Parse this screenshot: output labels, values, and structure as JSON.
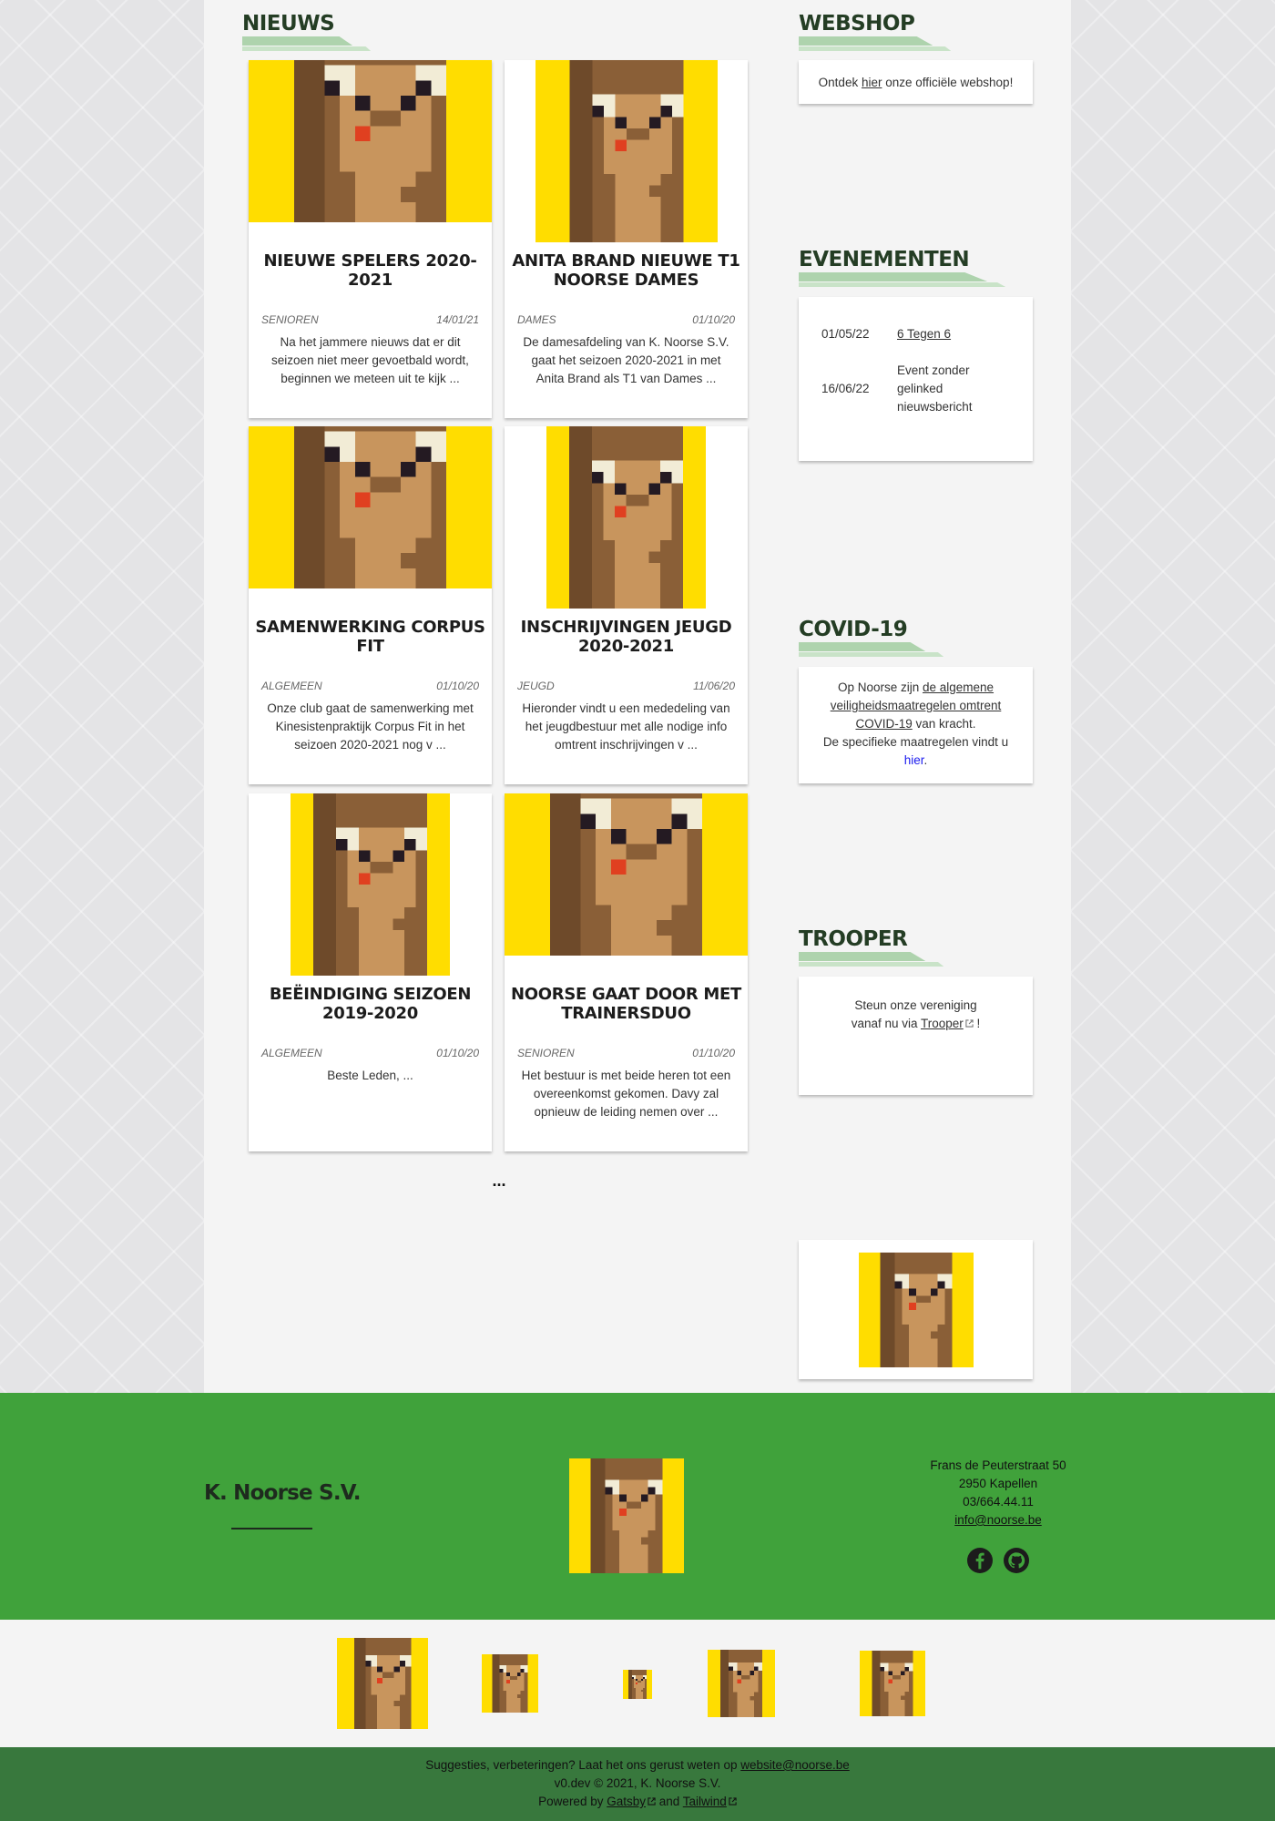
{
  "news": {
    "heading": "NIEUWS",
    "articles": [
      {
        "title": "NIEUWE SPELERS 2020-2021",
        "category": "SENIOREN",
        "date": "14/01/21",
        "excerpt": "Na het jammere nieuws dat er dit seizoen niet meer gevoetbald wordt, beginnen we meteen uit te kijk ..."
      },
      {
        "title": "ANITA BRAND NIEUWE T1 NOORSE DAMES",
        "category": "DAMES",
        "date": "01/10/20",
        "excerpt": "De damesafdeling van K. Noorse S.V. gaat het seizoen 2020-2021 in met Anita Brand als T1 van Dames ..."
      },
      {
        "title": "SAMENWERKING CORPUS FIT",
        "category": "ALGEMEEN",
        "date": "01/10/20",
        "excerpt": "Onze club gaat de samenwerking met Kinesistenpraktijk Corpus Fit in het seizoen 2020-2021 nog v ..."
      },
      {
        "title": "INSCHRIJVINGEN JEUGD 2020-2021",
        "category": "JEUGD",
        "date": "11/06/20",
        "excerpt": "Hieronder vindt u een mededeling van het jeugdbestuur met alle nodige info omtrent inschrijvingen v ..."
      },
      {
        "title": "BEËINDIGING SEIZOEN 2019-2020",
        "category": "ALGEMEEN",
        "date": "01/10/20",
        "excerpt": "Beste Leden,    ..."
      },
      {
        "title": "NOORSE GAAT DOOR MET TRAINERSDUO",
        "category": "SENIOREN",
        "date": "01/10/20",
        "excerpt": "Het bestuur is met beide heren tot een overeenkomst gekomen. Davy zal opnieuw de leiding nemen over ..."
      }
    ],
    "more": "..."
  },
  "webshop": {
    "heading": "WEBSHOP",
    "before": "Ontdek ",
    "link": "hier",
    "after": " onze officiële webshop!"
  },
  "events": {
    "heading": "EVENEMENTEN",
    "items": [
      {
        "date": "01/05/22",
        "name": "6 Tegen 6"
      },
      {
        "date": "16/06/22",
        "name": "Event zonder gelinked nieuwsbericht"
      }
    ]
  },
  "covid": {
    "heading": "COVID-19",
    "before": "Op Noorse zijn ",
    "link": "de algemene veiligheidsmaatregelen omtrent COVID-19",
    "after": " van kracht.",
    "line2": "De specifieke maatregelen vindt u",
    "link2": "hier",
    "end": "."
  },
  "trooper": {
    "heading": "TROOPER",
    "line1": "Steun onze vereniging",
    "before": "vanaf nu via ",
    "link": "Trooper",
    "after": " !"
  },
  "footer": {
    "club_name": "K. Noorse S.V.",
    "address": "Frans de Peuterstraat 50",
    "city": "2950 Kapellen",
    "phone": "03/664.44.11",
    "email": "info@noorse.be",
    "icons": [
      "facebook-icon",
      "github-icon"
    ]
  },
  "bottom": {
    "line1_text": "Suggesties, verbeteringen? Laat het ons gerust weten op ",
    "line1_link": "website@noorse.be",
    "line2": "v0.dev © 2021, K. Noorse S.V.",
    "line3_prefix": "Powered by ",
    "gatsby": "Gatsby",
    "and": " and ",
    "tailwind": "Tailwind"
  },
  "colors": {
    "footer_green": "#40a23b",
    "bottom_green": "#38783d",
    "mascot_bg": "#ffdd00",
    "link_blue": "#1a1aee"
  }
}
